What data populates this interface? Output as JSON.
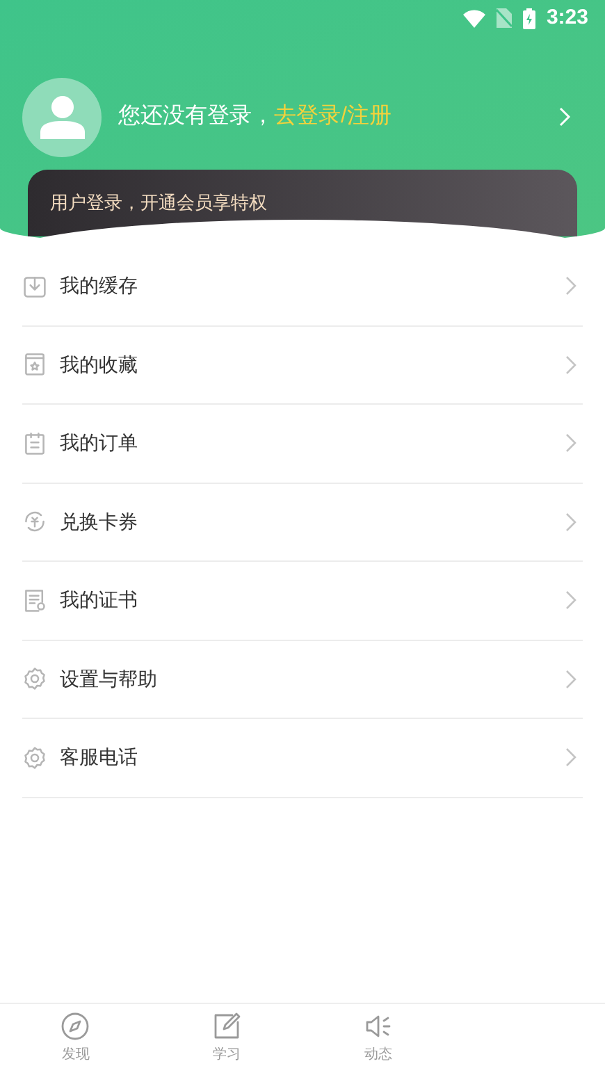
{
  "status_bar": {
    "time": "3:23"
  },
  "profile": {
    "prompt": "您还没有登录，",
    "login_link": "去登录/注册"
  },
  "vip_banner": {
    "text": "用户登录，开通会员享特权"
  },
  "menu": [
    {
      "kind": "download",
      "label": "我的缓存"
    },
    {
      "kind": "favorite",
      "label": "我的收藏"
    },
    {
      "kind": "order",
      "label": "我的订单"
    },
    {
      "kind": "exchange",
      "label": "兑换卡券"
    },
    {
      "kind": "certificate",
      "label": "我的证书"
    },
    {
      "kind": "settings",
      "label": "设置与帮助"
    },
    {
      "kind": "settings",
      "label": "客服电话"
    }
  ],
  "tabs": [
    {
      "kind": "discover",
      "label": "发现",
      "selected": false
    },
    {
      "kind": "study",
      "label": "学习",
      "selected": false
    },
    {
      "kind": "news",
      "label": "动态",
      "selected": false
    }
  ]
}
